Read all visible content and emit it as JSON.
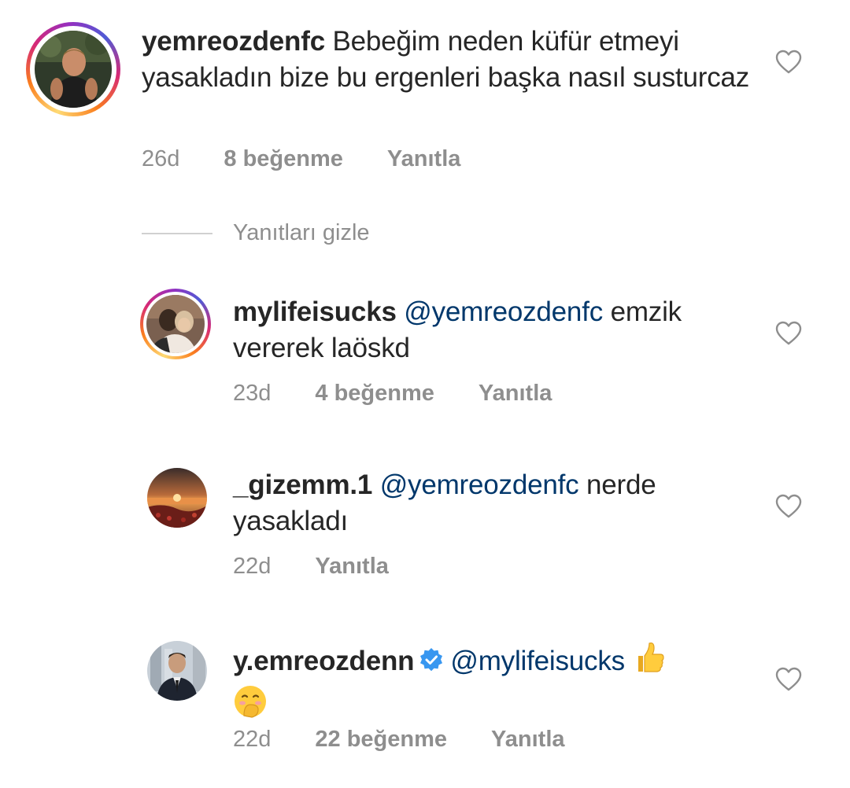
{
  "comments": [
    {
      "username": "yemreozdenfc",
      "mention": "",
      "text": "Bebeğim neden küfür etmeyi yasakladın bize bu ergenleri başka nasıl susturcaz",
      "time": "26d",
      "likes": "8 beğenme",
      "reply": "Yanıtla",
      "avatar": "man-outdoor-avatar"
    },
    {
      "username": "mylifeisucks",
      "mention": "@yemreozdenfc",
      "text": "emzik vererek laöskd",
      "time": "23d",
      "likes": "4 beğenme",
      "reply": "Yanıtla",
      "avatar": "couple-avatar"
    },
    {
      "username": "_gizemm.1",
      "mention": "@yemreozdenfc",
      "text": "nerde yasakladı",
      "time": "22d",
      "likes": "",
      "reply": "Yanıtla",
      "avatar": "sunset-avatar"
    },
    {
      "username": "y.emreozdenn",
      "mention": "@mylifeisucks",
      "text": "",
      "time": "22d",
      "likes": "22 beğenme",
      "reply": "Yanıtla",
      "avatar": "man-suit-avatar",
      "verified": true,
      "emojis": [
        "thumbs-up",
        "hand-over-mouth"
      ]
    }
  ],
  "hide_replies": "Yanıtları gizle",
  "colors": {
    "text": "#262626",
    "meta": "#8e8e8e",
    "mention": "#00376b",
    "verified": "#3897f0"
  }
}
